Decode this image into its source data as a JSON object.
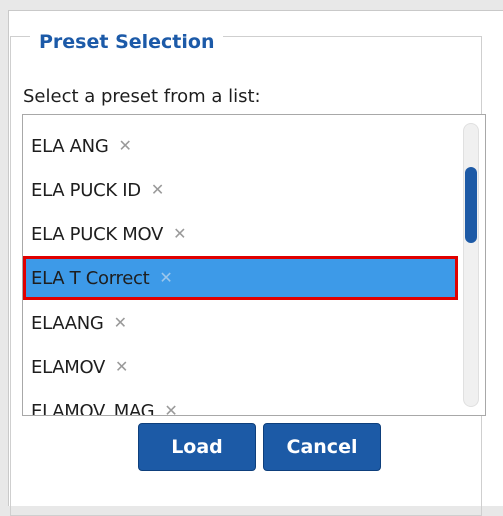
{
  "dialog": {
    "legend": "Preset Selection",
    "prompt": "Select a preset from a list:",
    "remove_glyph": "✕",
    "presets": [
      {
        "label": "ELA ANG",
        "selected": false
      },
      {
        "label": "ELA PUCK ID",
        "selected": false
      },
      {
        "label": "ELA PUCK MOV",
        "selected": false
      },
      {
        "label": "ELA T Correct",
        "selected": true
      },
      {
        "label": "ELAANG",
        "selected": false
      },
      {
        "label": "ELAMOV",
        "selected": false
      },
      {
        "label": "ELAMOV_MAG",
        "selected": false
      }
    ],
    "scroll_position": 0.25,
    "buttons": {
      "load": "Load",
      "cancel": "Cancel"
    }
  },
  "colors": {
    "accent": "#1c5aa6",
    "selection": "#3d9ae8",
    "highlight_border": "#e00000"
  }
}
